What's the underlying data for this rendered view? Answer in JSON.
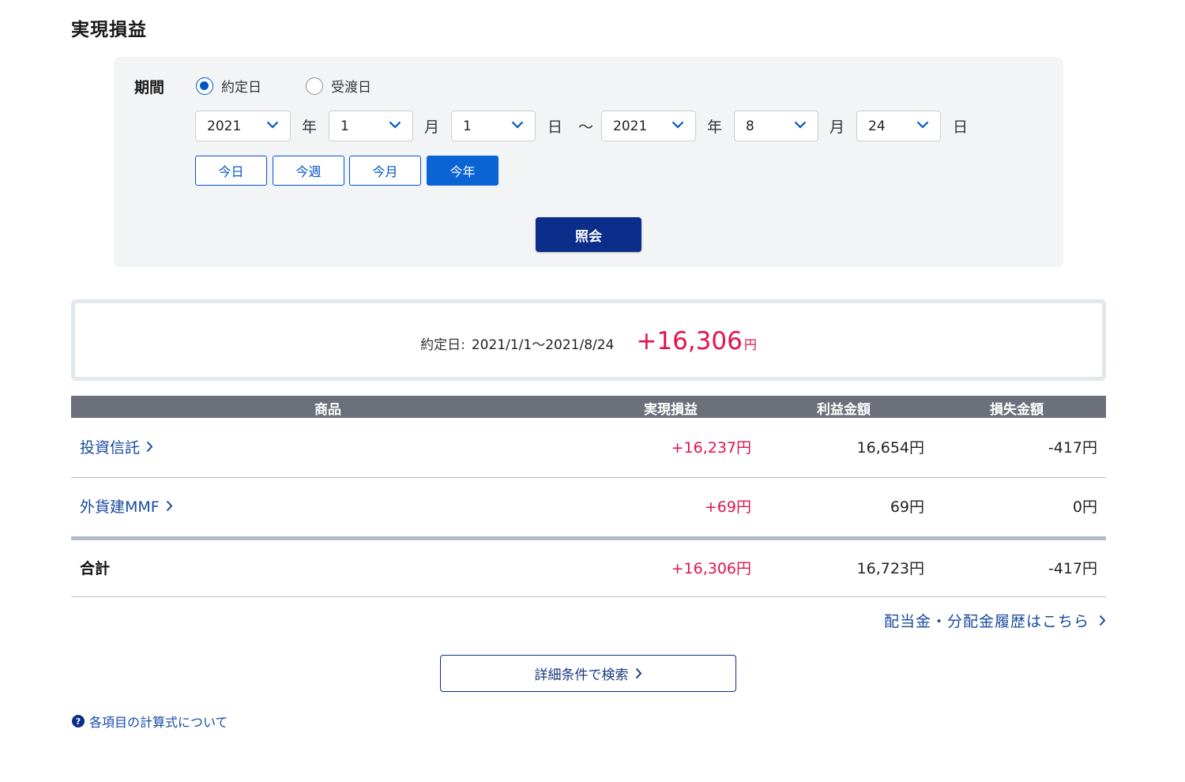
{
  "page": {
    "title": "実現損益"
  },
  "filter": {
    "period_label": "期間",
    "radio_options": [
      {
        "label": "約定日",
        "selected": true
      },
      {
        "label": "受渡日",
        "selected": false
      }
    ],
    "from": {
      "year": "2021",
      "month": "1",
      "day": "1"
    },
    "to": {
      "year": "2021",
      "month": "8",
      "day": "24"
    },
    "units": {
      "year": "年",
      "month": "月",
      "day": "日",
      "separator": "〜"
    },
    "quick_buttons": [
      {
        "label": "今日",
        "active": false
      },
      {
        "label": "今週",
        "active": false
      },
      {
        "label": "今月",
        "active": false
      },
      {
        "label": "今年",
        "active": true
      }
    ],
    "inquiry_label": "照会"
  },
  "summary": {
    "label": "約定日:",
    "range": "2021/1/1〜2021/8/24",
    "value": "+16,306",
    "unit": "円"
  },
  "table": {
    "headers": [
      "商品",
      "実現損益",
      "利益金額",
      "損失金額"
    ],
    "rows": [
      {
        "name": "投資信託",
        "pl": "+16,237円",
        "profit": "16,654円",
        "loss": "-417円"
      },
      {
        "name": "外貨建MMF",
        "pl": "+69円",
        "profit": "69円",
        "loss": "0円"
      }
    ],
    "total": {
      "name": "合計",
      "pl": "+16,306円",
      "profit": "16,723円",
      "loss": "-417円"
    }
  },
  "links": {
    "dividend": "配当金・分配金履歴はこちら",
    "detail_search": "詳細条件で検索",
    "help": "各項目の計算式について"
  },
  "colors": {
    "accent": "#0055c8",
    "primary_button": "#0b2e8a",
    "positive": "#e0144c",
    "header_bg": "#6b707a"
  }
}
